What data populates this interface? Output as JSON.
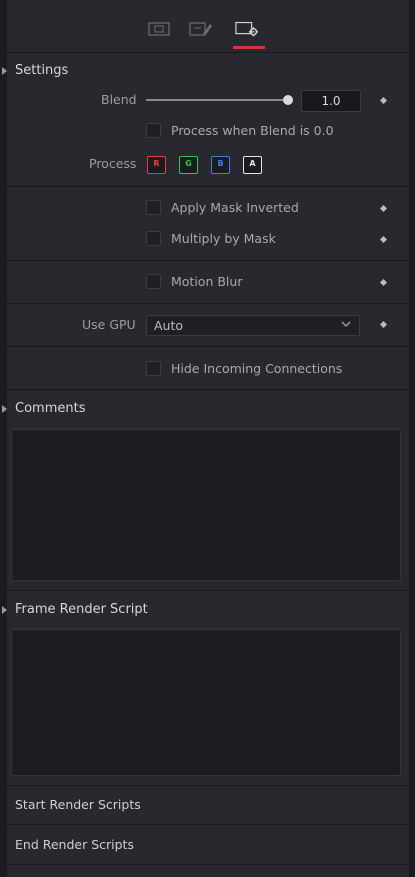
{
  "tabs": [
    {
      "icon": "image-tab-icon"
    },
    {
      "icon": "edit-tab-icon"
    },
    {
      "icon": "settings-tab-icon",
      "active": true
    }
  ],
  "accent_color": "#d23b3b",
  "settings": {
    "title": "Settings",
    "blend_label": "Blend",
    "blend_value": "1.0",
    "blend_fraction": 1.0,
    "process_when_blend_zero": "Process when Blend is 0.0",
    "process_label": "Process",
    "channels": [
      {
        "label": "R",
        "color": "#e0413f"
      },
      {
        "label": "G",
        "color": "#34c34a"
      },
      {
        "label": "B",
        "color": "#3b7fe0"
      },
      {
        "label": "A",
        "color": "#e6e6e6"
      }
    ],
    "apply_mask_inverted": "Apply Mask Inverted",
    "multiply_by_mask": "Multiply by Mask",
    "motion_blur": "Motion Blur",
    "use_gpu_label": "Use GPU",
    "use_gpu_value": "Auto",
    "hide_incoming": "Hide Incoming Connections"
  },
  "comments": {
    "title": "Comments"
  },
  "frame_render_script": {
    "title": "Frame Render Script"
  },
  "start_render_scripts": "Start Render Scripts",
  "end_render_scripts": "End Render Scripts"
}
